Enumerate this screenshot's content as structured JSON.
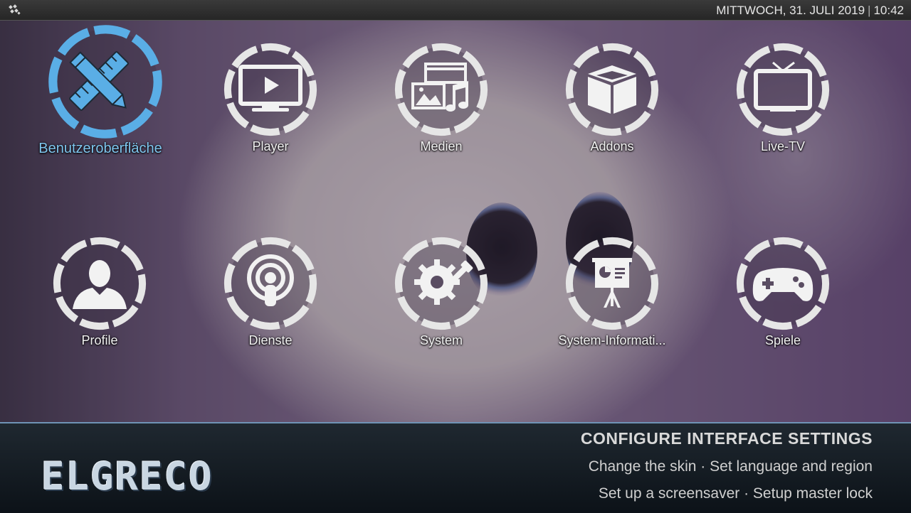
{
  "topbar": {
    "date": "MITTWOCH, 31. JULI 2019",
    "separator": "|",
    "time": "10:42"
  },
  "menu": {
    "items": [
      {
        "label": "Benutzeroberfläche",
        "icon": "pencil-ruler-icon",
        "selected": true
      },
      {
        "label": "Player",
        "icon": "monitor-play-icon"
      },
      {
        "label": "Medien",
        "icon": "media-pictures-music-icon"
      },
      {
        "label": "Addons",
        "icon": "open-box-icon"
      },
      {
        "label": "Live-TV",
        "icon": "tv-antenna-icon"
      },
      {
        "label": "Profile",
        "icon": "user-profile-icon"
      },
      {
        "label": "Dienste",
        "icon": "broadcast-icon"
      },
      {
        "label": "System",
        "icon": "gear-tools-icon"
      },
      {
        "label": "System-Informati...",
        "icon": "presentation-board-icon"
      },
      {
        "label": "Spiele",
        "icon": "gamepad-icon"
      }
    ]
  },
  "footer": {
    "brand": "ELGRECO",
    "title": "CONFIGURE INTERFACE SETTINGS",
    "line1": "Change the skin · Set language and region",
    "line2": "Set up a screensaver · Setup master lock"
  },
  "colors": {
    "accent": "#5aaee6",
    "ring": "#e8e8e8",
    "panel": "#121a22",
    "border": "#6f93b5"
  }
}
